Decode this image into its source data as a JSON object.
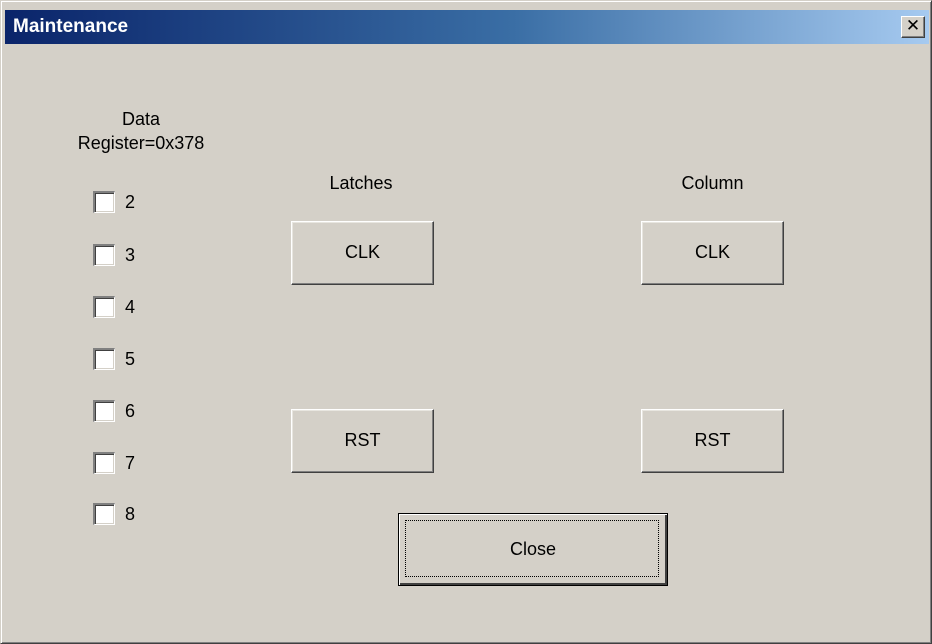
{
  "window": {
    "title": "Maintenance",
    "close_symbol": "✕",
    "colors": {
      "face": "#d4d0c8",
      "title_start": "#0a246a",
      "title_end": "#a6caf0",
      "title_text": "#ffffff"
    }
  },
  "data_register": {
    "label_line1": "Data",
    "label_line2": "Register=0x378",
    "checkboxes": [
      {
        "label": "2",
        "checked": false
      },
      {
        "label": "3",
        "checked": false
      },
      {
        "label": "4",
        "checked": false
      },
      {
        "label": "5",
        "checked": false
      },
      {
        "label": "6",
        "checked": false
      },
      {
        "label": "7",
        "checked": false
      },
      {
        "label": "8",
        "checked": false
      }
    ]
  },
  "latches": {
    "heading": "Latches",
    "clk_label": "CLK",
    "rst_label": "RST"
  },
  "column": {
    "heading": "Column",
    "clk_label": "CLK",
    "rst_label": "RST"
  },
  "footer": {
    "close_label": "Close"
  }
}
